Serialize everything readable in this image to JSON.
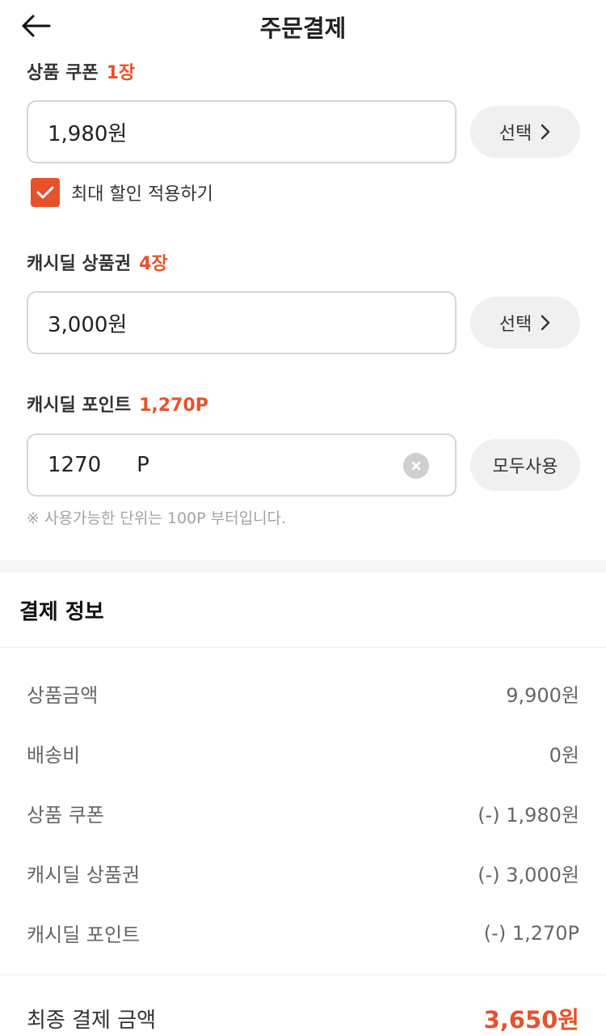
{
  "header": {
    "title": "주문결제"
  },
  "coupon": {
    "label": "상품 쿠폰",
    "count": "1장",
    "value": "1,980원",
    "select_label": "선택",
    "max_discount_label": "최대 할인 적용하기",
    "max_discount_checked": true
  },
  "voucher": {
    "label": "캐시딜 상품권",
    "count": "4장",
    "value": "3,000원",
    "select_label": "선택"
  },
  "points": {
    "label": "캐시딜 포인트",
    "available": "1,270P",
    "value": "1270",
    "unit": "P",
    "use_all_label": "모두사용",
    "hint": "※ 사용가능한 단위는 100P 부터입니다."
  },
  "payment_info": {
    "title": "결제 정보",
    "rows": [
      {
        "label": "상품금액",
        "value": "9,900원"
      },
      {
        "label": "배송비",
        "value": "0원"
      },
      {
        "label": "상품 쿠폰",
        "value": "(-) 1,980원"
      },
      {
        "label": "캐시딜 상품권",
        "value": "(-) 3,000원"
      },
      {
        "label": "캐시딜 포인트",
        "value": "(-) 1,270P"
      }
    ],
    "total_label": "최종 결제 금액",
    "total_value": "3,650원"
  },
  "colors": {
    "accent": "#e8522a",
    "pill_bg": "#f0f0f0",
    "border": "#d6d6d6"
  },
  "icons": {
    "back": "arrow-left-icon",
    "chevron": "chevron-right-icon",
    "check": "check-icon",
    "clear": "clear-x-icon"
  }
}
